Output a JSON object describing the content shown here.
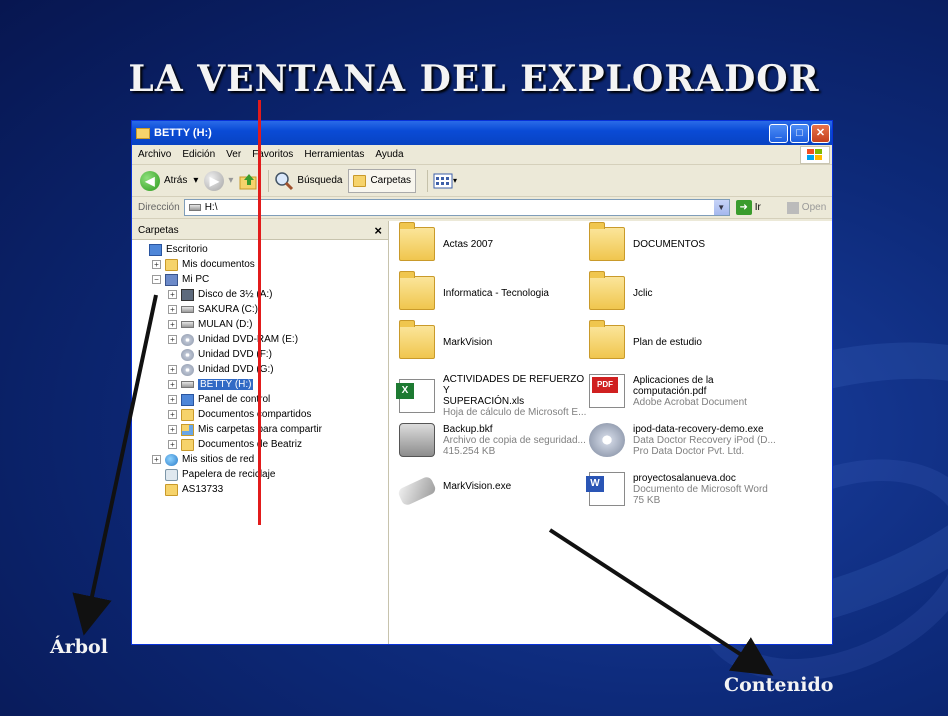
{
  "slide": {
    "title": "LA VENTANA DEL EXPLORADOR",
    "label_tree": "Árbol",
    "label_content": "Contenido"
  },
  "window": {
    "title": "BETTY (H:)",
    "controls": {
      "minimize": "_",
      "maximize": "□",
      "close": "✕"
    }
  },
  "menubar": [
    "Archivo",
    "Edición",
    "Ver",
    "Favoritos",
    "Herramientas",
    "Ayuda"
  ],
  "toolbar": {
    "back": "Atrás",
    "search": "Búsqueda",
    "folders": "Carpetas"
  },
  "address": {
    "label": "Dirección",
    "value": "H:\\",
    "go": "Ir",
    "open": "Open"
  },
  "tree": {
    "header": "Carpetas",
    "close": "×",
    "items": [
      {
        "label": "Escritorio",
        "icon": "desktop-icon",
        "level": 0,
        "expander": ""
      },
      {
        "label": "Mis documentos",
        "icon": "folder-icon",
        "level": 1,
        "expander": "+"
      },
      {
        "label": "Mi PC",
        "icon": "computer-icon",
        "level": 1,
        "expander": "−"
      },
      {
        "label": "Disco de 3½ (A:)",
        "icon": "floppy-icon",
        "level": 2,
        "expander": "+"
      },
      {
        "label": "SAKURA (C:)",
        "icon": "drive-icon",
        "level": 2,
        "expander": "+"
      },
      {
        "label": "MULAN (D:)",
        "icon": "drive-icon",
        "level": 2,
        "expander": "+"
      },
      {
        "label": "Unidad DVD-RAM (E:)",
        "icon": "cd-icon",
        "level": 2,
        "expander": "+"
      },
      {
        "label": "Unidad DVD (F:)",
        "icon": "cd-icon",
        "level": 2,
        "expander": ""
      },
      {
        "label": "Unidad DVD (G:)",
        "icon": "cd-icon",
        "level": 2,
        "expander": "+"
      },
      {
        "label": "BETTY (H:)",
        "icon": "drive-icon",
        "level": 2,
        "expander": "+",
        "selected": true
      },
      {
        "label": "Panel de control",
        "icon": "control-panel-icon",
        "level": 2,
        "expander": "+"
      },
      {
        "label": "Documentos compartidos",
        "icon": "folder-icon",
        "level": 2,
        "expander": "+"
      },
      {
        "label": "Mis carpetas para compartir",
        "icon": "shared-folder-icon",
        "level": 2,
        "expander": "+"
      },
      {
        "label": "Documentos de Beatriz",
        "icon": "folder-icon",
        "level": 2,
        "expander": "+"
      },
      {
        "label": "Mis sitios de red",
        "icon": "network-icon",
        "level": 1,
        "expander": "+"
      },
      {
        "label": "Papelera de reciclaje",
        "icon": "recycle-bin-icon",
        "level": 1,
        "expander": ""
      },
      {
        "label": "AS13733",
        "icon": "folder-icon",
        "level": 1,
        "expander": ""
      }
    ]
  },
  "content": {
    "items": [
      {
        "name": "Actas 2007",
        "icon": "folder-icon",
        "lines": []
      },
      {
        "name": "DOCUMENTOS",
        "icon": "folder-icon",
        "lines": []
      },
      {
        "name": "Informatica - Tecnologia",
        "icon": "folder-icon",
        "lines": []
      },
      {
        "name": "Jclic",
        "icon": "folder-icon",
        "lines": []
      },
      {
        "name": "MarkVision",
        "icon": "folder-icon",
        "lines": []
      },
      {
        "name": "Plan de estudio",
        "icon": "folder-icon",
        "lines": []
      },
      {
        "name": "ACTIVIDADES DE REFUERZO Y",
        "name2": "SUPERACIÓN.xls",
        "icon": "excel-file-icon",
        "lines": [
          "Hoja de cálculo de Microsoft E..."
        ]
      },
      {
        "name": "Aplicaciones de la",
        "name2": "computación.pdf",
        "icon": "pdf-file-icon",
        "lines": [
          "Adobe Acrobat Document"
        ]
      },
      {
        "name": "Backup.bkf",
        "icon": "backup-file-icon",
        "lines": [
          "Archivo de copia de seguridad...",
          "415.254 KB"
        ]
      },
      {
        "name": "ipod-data-recovery-demo.exe",
        "icon": "installer-icon",
        "lines": [
          "Data Doctor Recovery iPod (D...",
          "Pro Data Doctor Pvt. Ltd."
        ]
      },
      {
        "name": "MarkVision.exe",
        "icon": "usb-app-icon",
        "lines": []
      },
      {
        "name": "proyectosalanueva.doc",
        "icon": "word-file-icon",
        "lines": [
          "Documento de Microsoft Word",
          "75 KB"
        ]
      }
    ]
  },
  "colors": {
    "background": "#0d2a7a",
    "xp_title": "#0a4bd6",
    "selection": "#316ac5",
    "divider": "#e21b1b"
  }
}
